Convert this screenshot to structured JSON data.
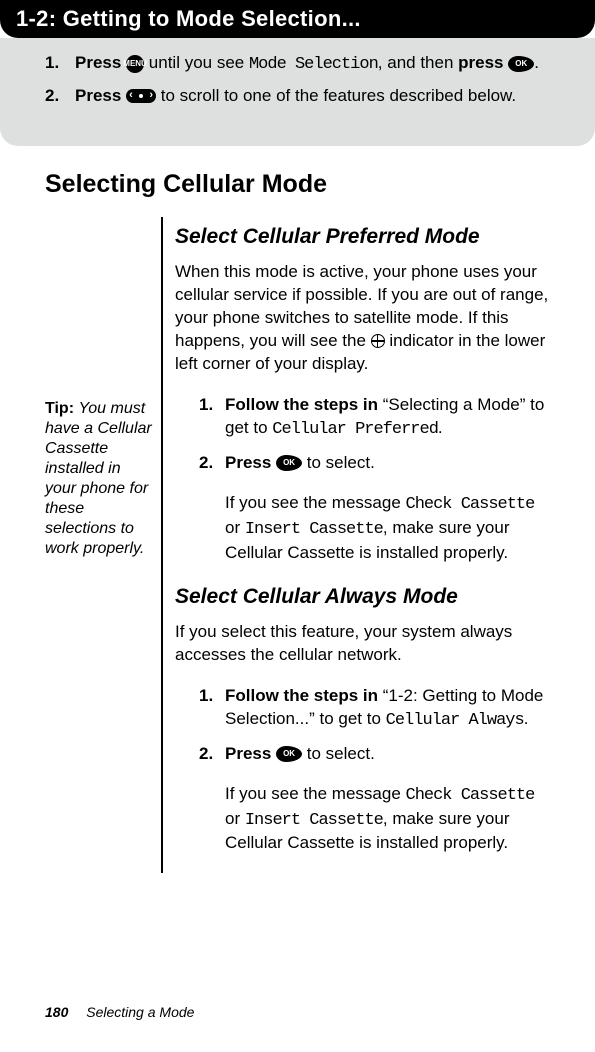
{
  "header": {
    "title": "1-2: Getting to Mode Selection..."
  },
  "gray_steps": {
    "step1": {
      "num": "1.",
      "lead": "Press",
      "mid1": " until you see ",
      "lcd1": "Mode Selection",
      "mid2": ", and then ",
      "lead2": "press",
      "end": "."
    },
    "step2": {
      "num": "2.",
      "lead": "Press",
      "rest": " to scroll to one of the features described below."
    }
  },
  "section_title": "Selecting Cellular Mode",
  "tip": {
    "label": "Tip: ",
    "text": "You must have a Cellular Cassette installed in your phone for these selections to work properly."
  },
  "sub1": {
    "heading": "Select Cellular Preferred Mode",
    "para1_a": "When this mode is active, your phone uses your cellular service if possible. If you are out of range, your phone switches to satellite mode. If this happens, you will see the ",
    "para1_b": " indicator in the lower left corner of your display.",
    "s1": {
      "num": "1.",
      "bold": "Follow the steps in",
      "rest_a": " “Selecting a Mode” to get to ",
      "lcd": "Cellular Preferred",
      "rest_b": "."
    },
    "s2": {
      "num": "2.",
      "bold": "Press",
      "rest": " to select."
    },
    "after_a": "If you see the message ",
    "after_lcd1": "Check Cassette",
    "after_mid": " or ",
    "after_lcd2": "Insert Cassette",
    "after_b": ", make sure your Cellular Cassette is installed properly."
  },
  "sub2": {
    "heading": "Select Cellular Always Mode",
    "para": "If you select this feature, your system always accesses the cellular network.",
    "s1": {
      "num": "1.",
      "bold": "Follow the steps in",
      "rest_a": " “1-2: Getting to Mode Selection...” to get to ",
      "lcd": "Cellular Always",
      "rest_b": "."
    },
    "s2": {
      "num": "2.",
      "bold": "Press",
      "rest": " to select."
    },
    "after_a": "If you see the message ",
    "after_lcd1": "Check Cassette",
    "after_mid": " or ",
    "after_lcd2": "Insert Cassette",
    "after_b": ", make sure your Cellular Cassette is installed properly."
  },
  "footer": {
    "page": "180",
    "title": "Selecting a Mode"
  },
  "icons": {
    "menu": "MENU",
    "ok": "OK"
  }
}
